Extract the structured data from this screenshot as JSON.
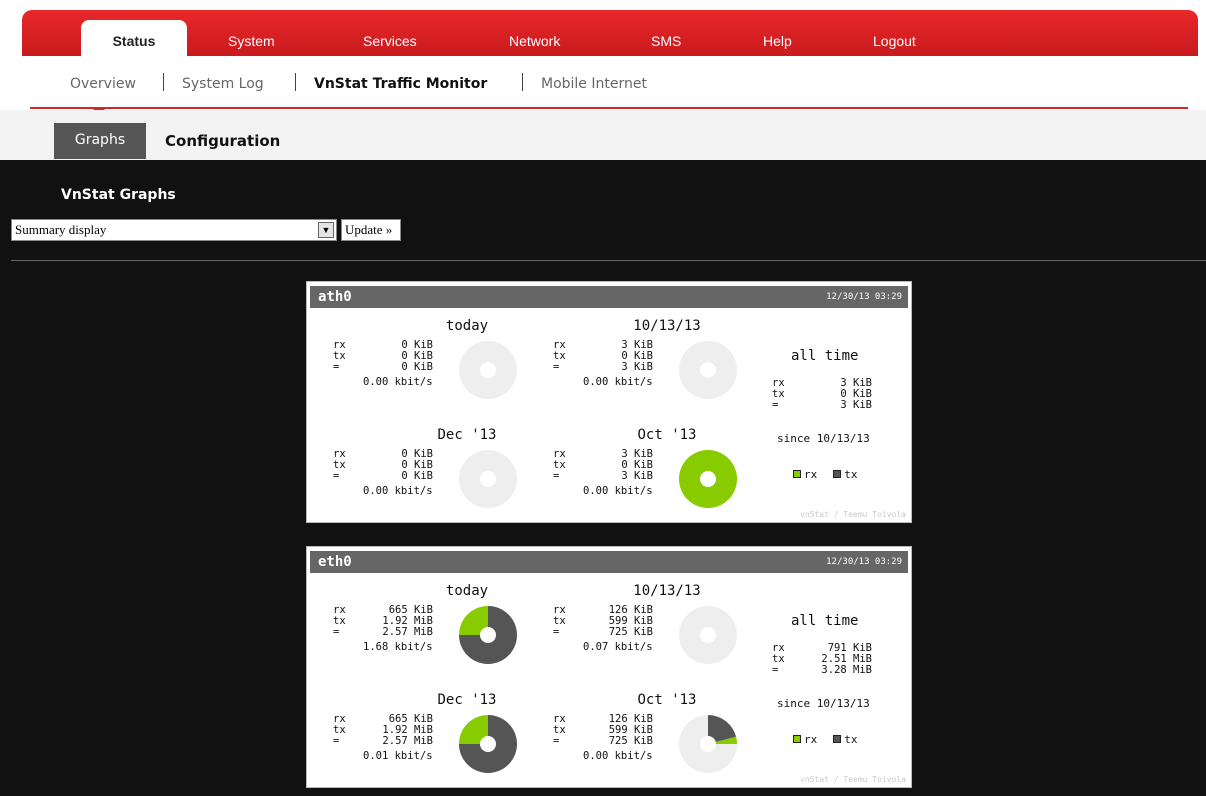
{
  "nav": {
    "tabs": [
      {
        "label": "Status",
        "active": true
      },
      {
        "label": "System"
      },
      {
        "label": "Services"
      },
      {
        "label": "Network"
      },
      {
        "label": "SMS"
      },
      {
        "label": "Help"
      },
      {
        "label": "Logout"
      }
    ],
    "subnav": [
      "Overview",
      "System Log",
      "VnStat Traffic Monitor",
      "Mobile Internet"
    ],
    "thirdnav": {
      "graphs": "Graphs",
      "configuration": "Configuration"
    }
  },
  "main": {
    "title": "VnStat Graphs",
    "select_value": "Summary display",
    "update_label": "Update »"
  },
  "colors": {
    "rx": "#88cc00",
    "tx": "#555555",
    "empty": "#eeeeee",
    "accent": "#d4252a"
  },
  "panels": [
    {
      "iface": "ath0",
      "timestamp": "12/30/13 03:29",
      "blocks": [
        {
          "title": "today",
          "rx": "0 KiB",
          "tx": "0 KiB",
          "total": "0 KiB",
          "rate": "0.00 kbit/s",
          "rx_frac": 0,
          "tx_frac": 0
        },
        {
          "title": "10/13/13",
          "rx": "3 KiB",
          "tx": "0 KiB",
          "total": "3 KiB",
          "rate": "0.00 kbit/s",
          "rx_frac": 0,
          "tx_frac": 0
        },
        {
          "title": "Dec '13",
          "rx": "0 KiB",
          "tx": "0 KiB",
          "total": "0 KiB",
          "rate": "0.00 kbit/s",
          "rx_frac": 0,
          "tx_frac": 0
        },
        {
          "title": "Oct '13",
          "rx": "3 KiB",
          "tx": "0 KiB",
          "total": "3 KiB",
          "rate": "0.00 kbit/s",
          "rx_frac": 1.0,
          "tx_frac": 0
        }
      ],
      "alltime": {
        "title": "all time",
        "rx": "3 KiB",
        "tx": "0 KiB",
        "total": "3 KiB",
        "since": "since 10/13/13"
      }
    },
    {
      "iface": "eth0",
      "timestamp": "12/30/13 03:29",
      "blocks": [
        {
          "title": "today",
          "rx": "665 KiB",
          "tx": "1.92 MiB",
          "total": "2.57 MiB",
          "rate": "1.68 kbit/s",
          "rx_frac": 0.25,
          "tx_frac": 0.75
        },
        {
          "title": "10/13/13",
          "rx": "126 KiB",
          "tx": "599 KiB",
          "total": "725 KiB",
          "rate": "0.07 kbit/s",
          "rx_frac": 0,
          "tx_frac": 0
        },
        {
          "title": "Dec '13",
          "rx": "665 KiB",
          "tx": "1.92 MiB",
          "total": "2.57 MiB",
          "rate": "0.01 kbit/s",
          "rx_frac": 0.25,
          "tx_frac": 0.75
        },
        {
          "title": "Oct '13",
          "rx": "126 KiB",
          "tx": "599 KiB",
          "total": "725 KiB",
          "rate": "0.00 kbit/s",
          "rx_frac": 0.04,
          "tx_frac": 0.21
        }
      ],
      "alltime": {
        "title": "all time",
        "rx": "791 KiB",
        "tx": "2.51 MiB",
        "total": "3.28 MiB",
        "since": "since 10/13/13"
      }
    }
  ],
  "stat_labels": {
    "rx": "rx",
    "tx": "tx",
    "total": "="
  },
  "legend": {
    "rx": "rx",
    "tx": "tx"
  },
  "credit": "vnStat / Teemu Toivola"
}
